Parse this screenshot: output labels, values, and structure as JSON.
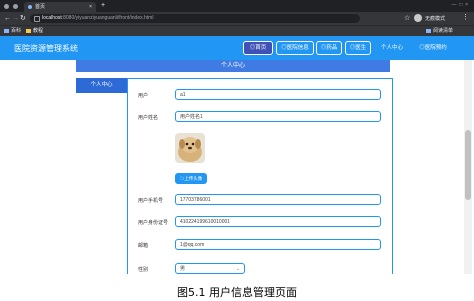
{
  "browser": {
    "tab_title": "首页",
    "url_host": "localhost",
    "url_path": ":8080/yiyuanziyuanguanli/front/index.html",
    "profile_name": "无痕模式",
    "bookmarks": [
      "百科",
      "教程"
    ],
    "reading_list": "阅读清单"
  },
  "app": {
    "brand": "医院资源管理系统",
    "nav": [
      {
        "label": "◎首页"
      },
      {
        "label": "◎医院信息"
      },
      {
        "label": "◎药品"
      },
      {
        "label": "◎医生"
      },
      {
        "label": "个人中心"
      },
      {
        "label": "◎医院预约"
      }
    ]
  },
  "section_title": "个人中心",
  "sidebar": {
    "item": "个人中心"
  },
  "form": {
    "username_label": "用户",
    "username_value": "a1",
    "name_label": "用户姓名",
    "name_value": "用户姓名1",
    "upload_label": "上传头像",
    "phone_label": "用户手机号",
    "phone_value": "17703786001",
    "idcard_label": "用户身份证号",
    "idcard_value": "410224199610010001",
    "email_label": "邮箱",
    "email_value": "1@qq.com",
    "gender_label": "性别",
    "gender_value": "男"
  },
  "caption": "图5.1 用户信息管理页面",
  "colors": {
    "primary": "#2196f3",
    "section": "#3f7be3",
    "sidebar": "#2e6ad6"
  }
}
